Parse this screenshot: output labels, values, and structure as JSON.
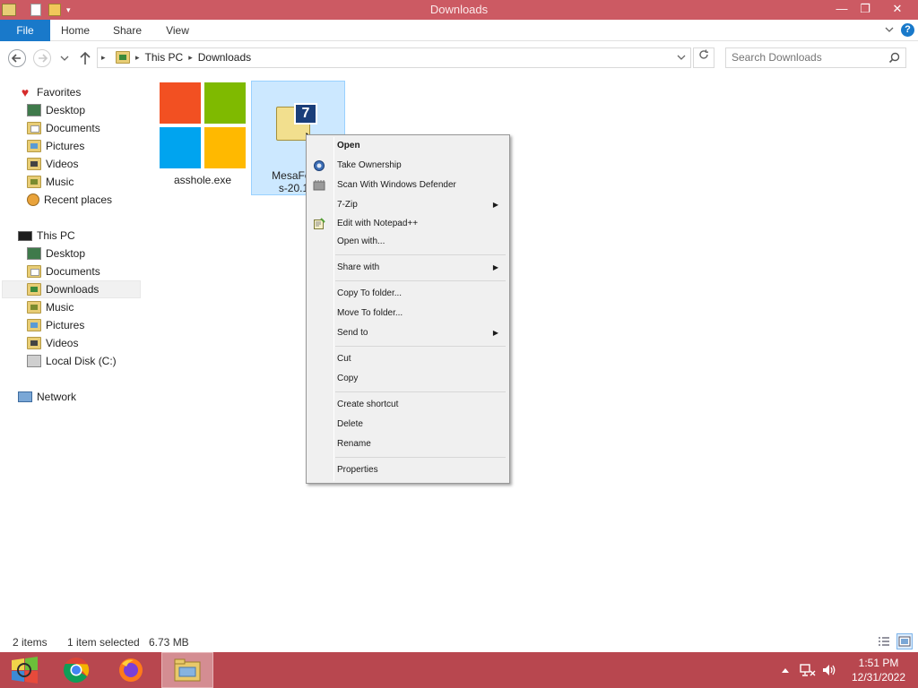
{
  "window": {
    "title": "Downloads",
    "controls": {
      "minimize": "—",
      "restore": "❐",
      "close": "✕"
    }
  },
  "ribbon": {
    "tabs": [
      {
        "label": "File"
      },
      {
        "label": "Home"
      },
      {
        "label": "Share"
      },
      {
        "label": "View"
      }
    ],
    "help": "?"
  },
  "address": {
    "crumbs": [
      "This PC",
      "Downloads"
    ],
    "separator": "›",
    "search_placeholder": "Search Downloads"
  },
  "nav_pane": {
    "favorites": {
      "label": "Favorites",
      "items": [
        "Desktop",
        "Documents",
        "Pictures",
        "Videos",
        "Music",
        "Recent places"
      ]
    },
    "this_pc": {
      "label": "This PC",
      "items": [
        "Desktop",
        "Documents",
        "Downloads",
        "Music",
        "Pictures",
        "Videos",
        "Local Disk (C:)"
      ],
      "selected": "Downloads"
    },
    "network": {
      "label": "Network"
    }
  },
  "files": [
    {
      "name": "asshole.exe",
      "icon": "windows-logo-icon"
    },
    {
      "name_line1": "MesaForW",
      "name_line2": "s-20.1.8",
      "icon": "7zip-archive-icon",
      "selected": true
    }
  ],
  "context_menu": {
    "groups": [
      [
        {
          "label": "Open",
          "bold": true
        },
        {
          "label": "Take Ownership",
          "icon": "ownership-icon"
        },
        {
          "label": "Scan With Windows Defender",
          "icon": "defender-icon"
        },
        {
          "label": "7-Zip",
          "submenu": true
        },
        {
          "label": "Edit with Notepad++",
          "icon": "notepad-plus-icon"
        },
        {
          "label": "Open with..."
        }
      ],
      [
        {
          "label": "Share with",
          "submenu": true
        }
      ],
      [
        {
          "label": "Copy To folder..."
        },
        {
          "label": "Move To folder..."
        },
        {
          "label": "Send to",
          "submenu": true
        }
      ],
      [
        {
          "label": "Cut"
        },
        {
          "label": "Copy"
        }
      ],
      [
        {
          "label": "Create shortcut"
        },
        {
          "label": "Delete"
        },
        {
          "label": "Rename"
        }
      ],
      [
        {
          "label": "Properties"
        }
      ]
    ]
  },
  "status": {
    "item_count": "2 items",
    "selection": "1 item selected",
    "size": "6.73 MB"
  },
  "taskbar": {
    "apps": [
      "start-icon",
      "chrome-icon",
      "firefox-icon",
      "file-explorer-icon"
    ],
    "time": "1:51 PM",
    "date": "12/31/2022"
  },
  "colors": {
    "titlebar": "#cc5a63",
    "taskbar": "#b8474f",
    "accent": "#1979ca",
    "selection": "#cce8ff"
  }
}
